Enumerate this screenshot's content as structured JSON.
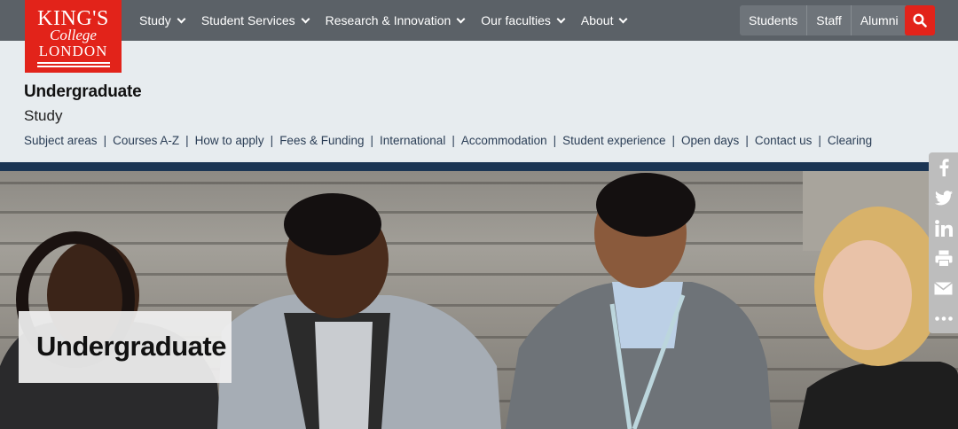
{
  "logo": {
    "line1": "KING'S",
    "line2": "College",
    "line3": "LONDON"
  },
  "nav": {
    "items": [
      {
        "label": "Study"
      },
      {
        "label": "Student Services"
      },
      {
        "label": "Research & Innovation"
      },
      {
        "label": "Our faculties"
      },
      {
        "label": "About"
      }
    ],
    "audience": [
      "Students",
      "Staff",
      "Alumni"
    ]
  },
  "section": {
    "title": "Undergraduate",
    "subtitle": "Study",
    "links": [
      "Subject areas",
      "Courses A-Z",
      "How to apply",
      "Fees & Funding",
      "International",
      "Accommodation",
      "Student experience",
      "Open days",
      "Contact us",
      "Clearing"
    ]
  },
  "hero": {
    "label": "Undergraduate"
  },
  "share": [
    "facebook-icon",
    "twitter-icon",
    "linkedin-icon",
    "print-icon",
    "email-icon",
    "more-icon"
  ],
  "colors": {
    "brand_red": "#e2231a",
    "nav_grey": "#5b6167",
    "navy": "#1b3554",
    "sub_bg": "#e7ecef"
  }
}
